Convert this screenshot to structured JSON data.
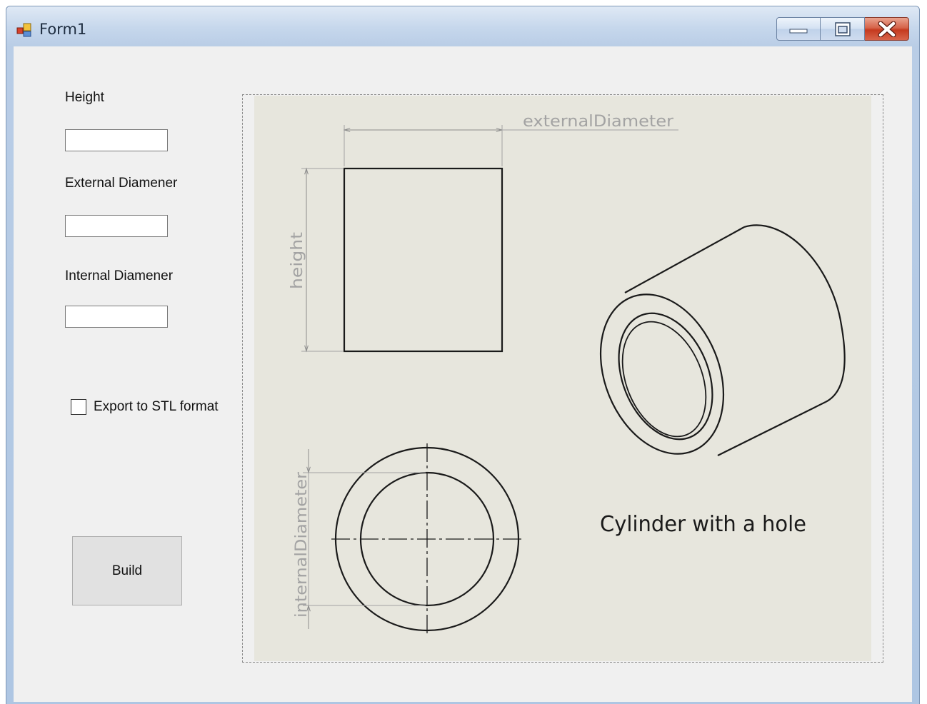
{
  "window": {
    "title": "Form1"
  },
  "form": {
    "height_label": "Height",
    "height_value": "",
    "external_label": "External Diamener",
    "external_value": "",
    "internal_label": "Internal Diamener",
    "internal_value": "",
    "export_label": "Export to STL format",
    "export_checked": false,
    "build_label": "Build"
  },
  "drawing": {
    "external_dim_label": "externalDiameter",
    "height_dim_label": "height",
    "internal_dim_label": "internalDiameter",
    "caption": "Cylinder with a hole"
  },
  "colors": {
    "drawing_background": "#e7e6dd",
    "dimension_text": "#a3a3a3",
    "window_frame": "#b9cde6",
    "close_button": "#c53a1f",
    "form_background": "#f0f0f0"
  }
}
